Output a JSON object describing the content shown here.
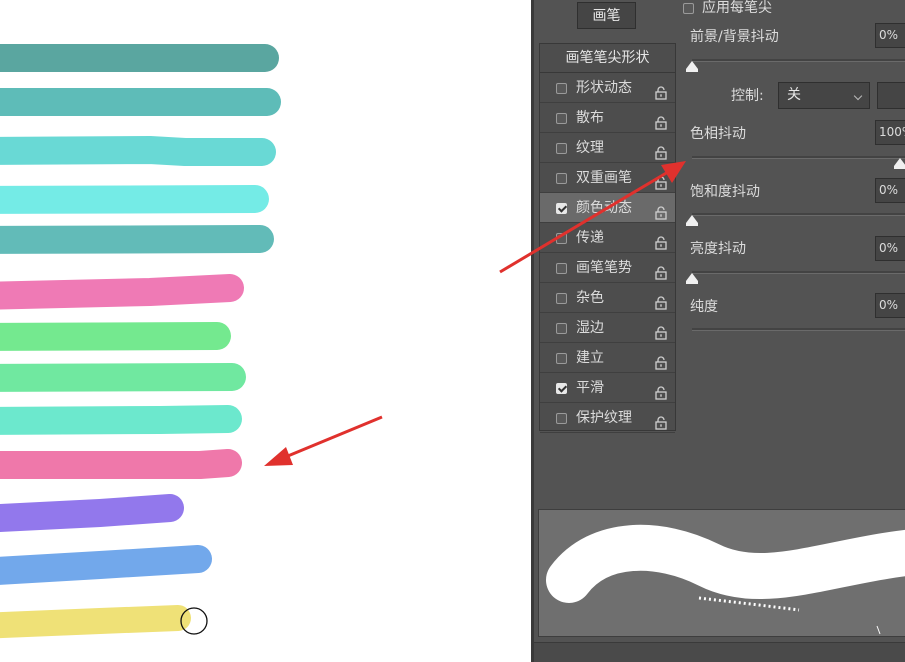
{
  "colors": {
    "panel_bg": "#535353",
    "arrow": "#e0312d",
    "strokes": [
      "#5aa6a0",
      "#5ebcb8",
      "#69d9d5",
      "#74ebe6",
      "#62bbb8",
      "#ef7ab5",
      "#74e98f",
      "#70e8a0",
      "#6ce8cd",
      "#ef78aa",
      "#9278ec",
      "#72a8eb",
      "#efe177"
    ]
  },
  "panel": {
    "brush_button": "画笔",
    "apply_per_tip": {
      "label": "应用每笔尖",
      "checked": false
    },
    "list_header": "画笔笔尖形状",
    "items": [
      {
        "label": "形状动态",
        "checked": false,
        "selected": false
      },
      {
        "label": "散布",
        "checked": false,
        "selected": false
      },
      {
        "label": "纹理",
        "checked": false,
        "selected": false
      },
      {
        "label": "双重画笔",
        "checked": false,
        "selected": false
      },
      {
        "label": "颜色动态",
        "checked": true,
        "selected": true
      },
      {
        "label": "传递",
        "checked": false,
        "selected": false
      },
      {
        "label": "画笔笔势",
        "checked": false,
        "selected": false
      },
      {
        "label": "杂色",
        "checked": false,
        "selected": false
      },
      {
        "label": "湿边",
        "checked": false,
        "selected": false
      },
      {
        "label": "建立",
        "checked": false,
        "selected": false
      },
      {
        "label": "平滑",
        "checked": true,
        "selected": false
      },
      {
        "label": "保护纹理",
        "checked": false,
        "selected": false
      }
    ],
    "settings": {
      "fg_bg_jitter": {
        "label": "前景/背景抖动",
        "value": "0%",
        "level": 0
      },
      "control": {
        "label": "控制:",
        "value": "关"
      },
      "hue_jitter": {
        "label": "色相抖动",
        "value": "100%",
        "level": 1
      },
      "saturation_jitter": {
        "label": "饱和度抖动",
        "value": "0%",
        "level": 0
      },
      "brightness_jitter": {
        "label": "亮度抖动",
        "value": "0%",
        "level": 0
      },
      "purity": {
        "label": "纯度",
        "value": "0%",
        "level": 0
      }
    }
  }
}
